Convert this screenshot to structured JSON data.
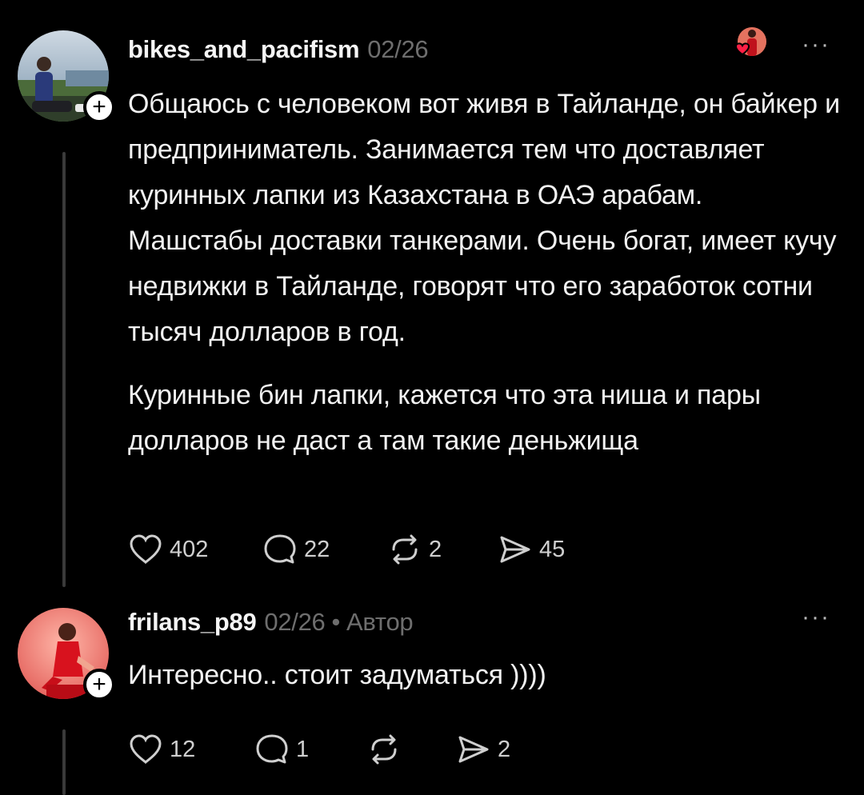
{
  "posts": [
    {
      "username": "bikes_and_pacifism",
      "date": "02/26",
      "paragraphs": [
        "Общаюсь с человеком вот живя в Тайланде, он байкер и предприниматель. Занимается тем что доставляет куринных лапки из Казахстана в ОАЭ арабам. Машстабы доставки танкерами. Очень богат, имеет кучу недвижки в Тайланде, говорят что его заработок сотни тысяч долларов в год.",
        "Куринные бин лапки, кажется что эта ниша и пары долларов не даст а там такие деньжища"
      ],
      "likes": "402",
      "comments": "22",
      "reposts": "2",
      "shares": "45",
      "more_label": "···"
    },
    {
      "username": "frilans_p89",
      "date": "02/26",
      "separator": "•",
      "author_badge": "Автор",
      "paragraphs": [
        "Интересно.. стоит  задуматься ))))"
      ],
      "likes": "12",
      "comments": "1",
      "reposts": "",
      "shares": "2",
      "more_label": "···"
    }
  ],
  "follow_label": "+",
  "icons": {
    "like": "heart-outline-icon",
    "comment": "speech-bubble-icon",
    "repost": "repost-arrows-icon",
    "share": "paper-plane-icon",
    "liked_by": "heart-filled-icon"
  },
  "colors": {
    "background": "#000000",
    "text": "#f2f2f2",
    "muted": "#6e6e6e",
    "like_heart": "#ff2d55"
  }
}
